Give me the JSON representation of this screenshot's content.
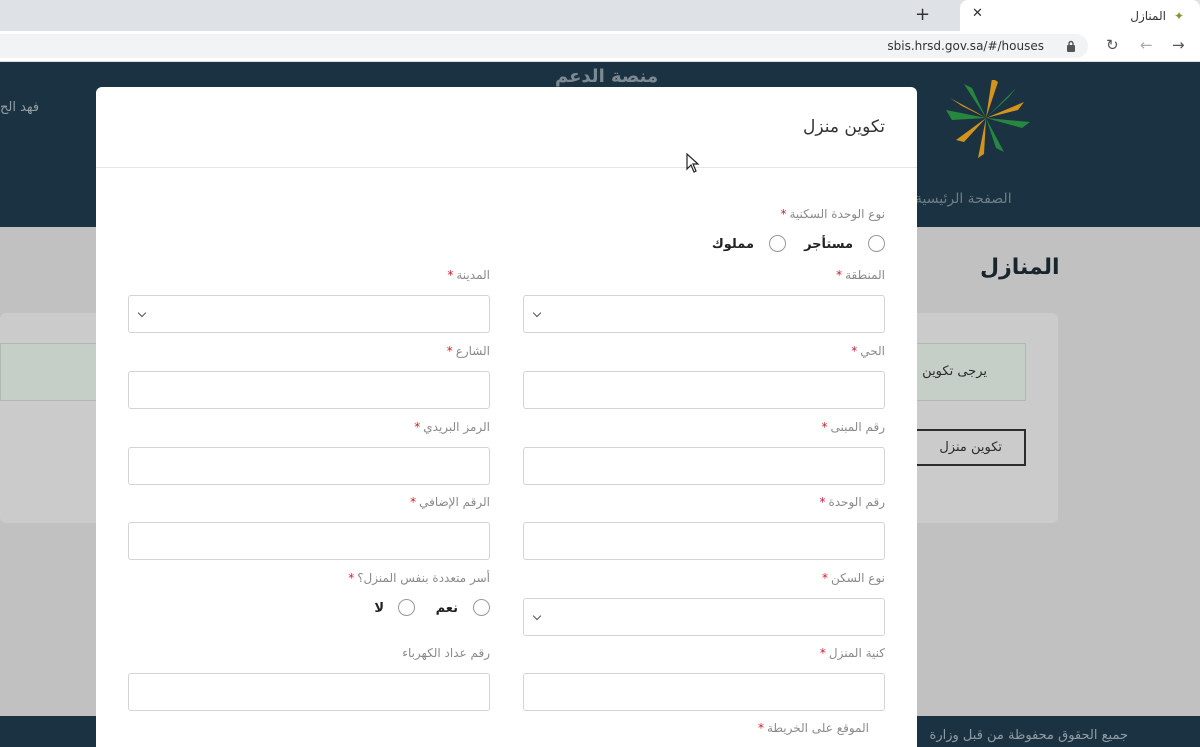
{
  "browser": {
    "tab_title": "المنازل",
    "url": "sbis.hrsd.gov.sa/#/houses"
  },
  "site": {
    "header_user": "فهد الح",
    "platform_title": "منصة الدعم",
    "home_link": "الصفحة الرئيسية",
    "page_title": "المنازل",
    "notice_text": "يرجى تكوين",
    "create_button": "تكوين منزل",
    "footer_text": "جميع الحقوق محفوظة من قبل وزارة"
  },
  "modal": {
    "title": "تكوين منزل",
    "unit_type_label": "نوع الوحدة السكنية",
    "unit_type_options": [
      "مستأجر",
      "مملوك"
    ],
    "region_label": "المنطقة",
    "city_label": "المدينة",
    "district_label": "الحي",
    "street_label": "الشارع",
    "building_no_label": "رقم المبنى",
    "postal_code_label": "الرمز البريدي",
    "unit_no_label": "رقم الوحدة",
    "additional_no_label": "الرقم الإضافي",
    "housing_type_label": "نوع السكن",
    "multi_family_label": "أسر متعددة بنفس المنزل؟",
    "multi_family_options": [
      "نعم",
      "لا"
    ],
    "house_name_label": "كنية المنزل",
    "electricity_meter_label": "رقم عداد الكهرباء",
    "map_location_label": "الموقع على الخريطة",
    "required_mark": "*"
  }
}
